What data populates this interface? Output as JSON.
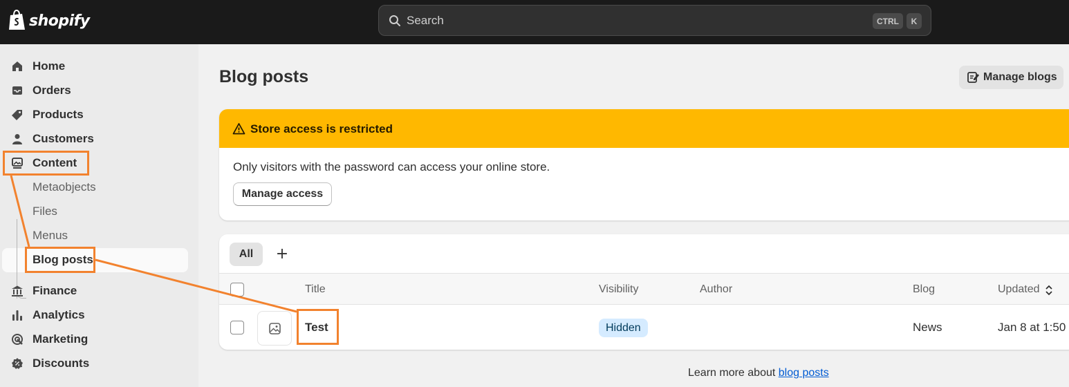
{
  "brand": {
    "name": "shopify"
  },
  "search": {
    "placeholder": "Search",
    "shortcut_modifier": "CTRL",
    "shortcut_key": "K"
  },
  "sidebar": {
    "items": [
      {
        "label": "Home",
        "icon": "home-icon"
      },
      {
        "label": "Orders",
        "icon": "inbox-icon"
      },
      {
        "label": "Products",
        "icon": "tag-icon"
      },
      {
        "label": "Customers",
        "icon": "person-icon"
      },
      {
        "label": "Content",
        "icon": "image-frame-icon"
      },
      {
        "label": "Finance",
        "icon": "bank-icon"
      },
      {
        "label": "Analytics",
        "icon": "bar-chart-icon"
      },
      {
        "label": "Marketing",
        "icon": "target-icon"
      },
      {
        "label": "Discounts",
        "icon": "discount-icon"
      }
    ],
    "content_subitems": [
      {
        "label": "Metaobjects"
      },
      {
        "label": "Files"
      },
      {
        "label": "Menus"
      },
      {
        "label": "Blog posts",
        "active": true
      }
    ]
  },
  "main": {
    "title": "Blog posts",
    "manage_blogs_label": "Manage blogs",
    "banner": {
      "title": "Store access is restricted",
      "text": "Only visitors with the password can access your online store.",
      "button_label": "Manage access",
      "color": "#ffb800"
    },
    "tabs": [
      {
        "label": "All",
        "selected": true
      }
    ],
    "add_tab_label": "+",
    "table": {
      "columns": [
        "Title",
        "Visibility",
        "Author",
        "Blog",
        "Updated"
      ],
      "rows": [
        {
          "title": "Test",
          "visibility": "Hidden",
          "author": "",
          "blog": "News",
          "updated": "Jan 8 at 1:50"
        }
      ]
    },
    "footer": {
      "prefix": "Learn more about ",
      "link_label": "blog posts"
    }
  },
  "annotation": {
    "color": "#f2822e"
  }
}
